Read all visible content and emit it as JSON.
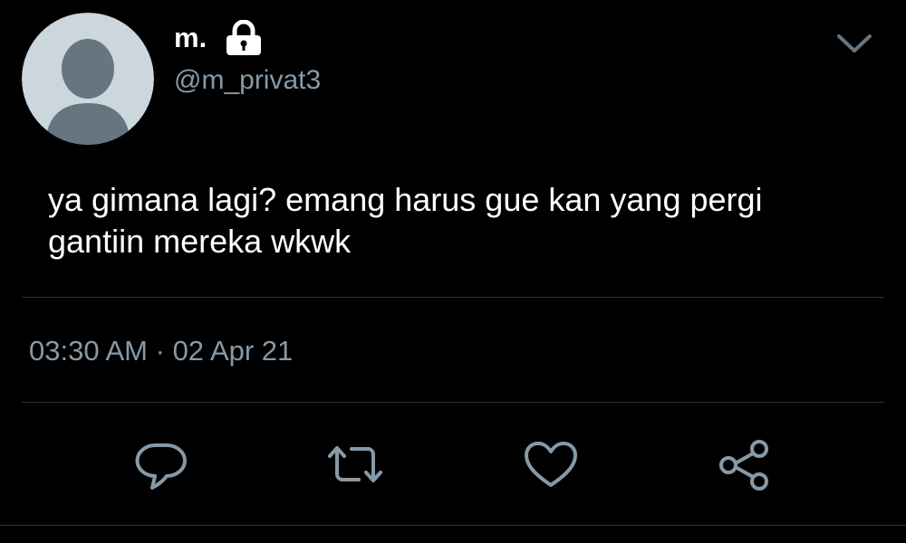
{
  "tweet": {
    "display_name": "m.",
    "handle": "@m_privat3",
    "text_lines": [
      "ya gimana lagi? emang harus gue kan yang pergi",
      "gantiin mereka wkwk"
    ],
    "time": "03:30 AM",
    "separator": "·",
    "date": "02 Apr 21"
  },
  "icons": {
    "protected": "lock-icon",
    "more": "chevron-down-icon",
    "reply": "reply-icon",
    "retweet": "retweet-icon",
    "like": "heart-icon",
    "share": "share-icon"
  },
  "colors": {
    "background": "#000000",
    "text_primary": "#ffffff",
    "text_secondary": "#8899a6",
    "divider": "#2f3336",
    "avatar_bg": "#ccd6dd",
    "avatar_figure": "#66757f"
  }
}
